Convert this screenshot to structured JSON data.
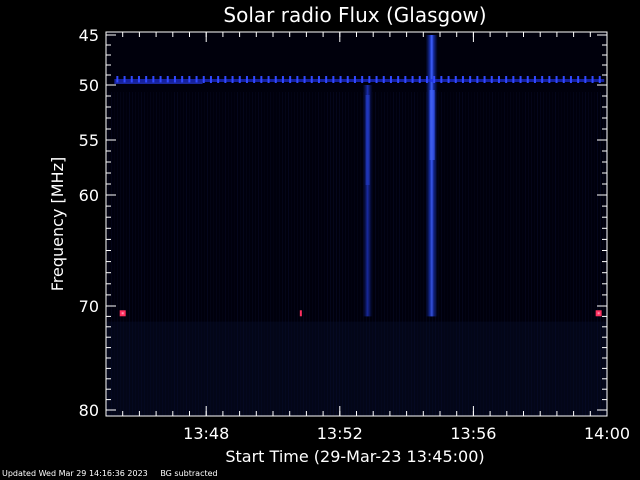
{
  "chart_data": {
    "type": "heatmap",
    "title": "Solar radio Flux (Glasgow)",
    "xlabel": "Start Time (29-Mar-23 13:45:00)",
    "ylabel": "Frequency [MHz]",
    "xlim": [
      "13:45:00",
      "14:00:00"
    ],
    "ylim": [
      45,
      80
    ],
    "y_axis_inverted": true,
    "grid": false,
    "colormap": "black-blue",
    "x_ticks": [
      "13:48",
      "13:52",
      "13:56",
      "14:00"
    ],
    "y_ticks": [
      45,
      50,
      55,
      60,
      70,
      80
    ],
    "features": [
      {
        "kind": "burst",
        "time": "13:54:45",
        "freq_range": [
          45,
          71
        ],
        "intensity": 0.95
      },
      {
        "kind": "burst",
        "time": "13:52:50",
        "freq_range": [
          50,
          71
        ],
        "intensity": 0.55
      },
      {
        "kind": "interference-band",
        "freq": 49.5,
        "time_range": [
          "13:45:15",
          "13:59:55"
        ],
        "intensity": 0.8
      },
      {
        "kind": "interference-spot",
        "time": "13:45:30",
        "freq": 70.7,
        "color": "#ff3060"
      },
      {
        "kind": "interference-spot",
        "time": "13:50:50",
        "freq": 70.7,
        "color": "#ff3060"
      },
      {
        "kind": "interference-spot",
        "time": "13:59:45",
        "freq": 70.7,
        "color": "#ff3060"
      }
    ],
    "colors": {
      "background": "#000000",
      "plot": "#00000c",
      "signal": "#2a4cff",
      "axis": "#ffffff"
    }
  },
  "footer": {
    "updated": "Updated Wed Mar 29 14:16:36 2023",
    "note": "BG subtracted"
  }
}
